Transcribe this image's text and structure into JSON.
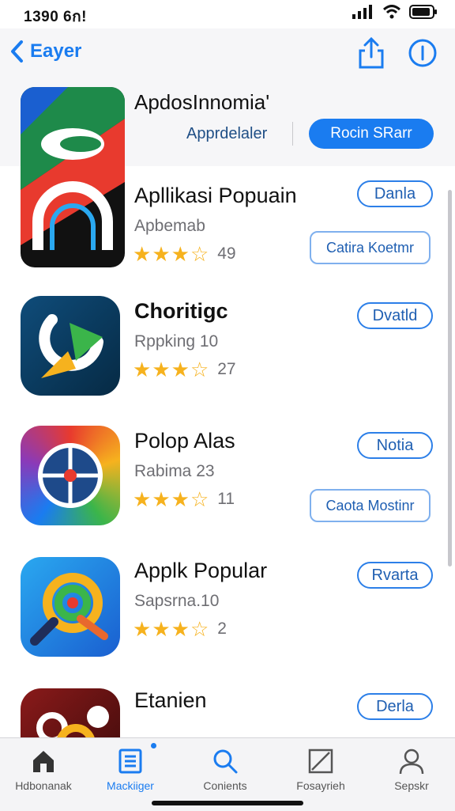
{
  "status": {
    "time": "1390 6ก!"
  },
  "nav": {
    "back_label": "Eayer"
  },
  "featured": {
    "title": "ApdosInnomia'",
    "subtitle": "Apprdelaler",
    "button": "Rocin SRarr"
  },
  "apps": [
    {
      "name": "Apllikasi Popuain",
      "subtitle": "Apbemab",
      "rating_stars": 3.5,
      "rating_count": "49",
      "action": "Danla",
      "secondary_action": "Catira Koetmr"
    },
    {
      "name": "Choritigc",
      "subtitle": "Rppking 10",
      "rating_stars": 3.5,
      "rating_count": "27",
      "action": "Dvatld",
      "secondary_action": ""
    },
    {
      "name": "Polop Alas",
      "subtitle": "Rabima 23",
      "rating_stars": 3.5,
      "rating_count": "11",
      "action": "Notia",
      "secondary_action": "Caota Mostinr"
    },
    {
      "name": "Applk Popular",
      "subtitle": "Sapsrna.10",
      "rating_stars": 3.5,
      "rating_count": "2",
      "action": "Rvarta",
      "secondary_action": ""
    },
    {
      "name": "Etanien",
      "subtitle": "",
      "rating_stars": 0,
      "rating_count": "",
      "action": "Derla",
      "secondary_action": ""
    }
  ],
  "tabs": [
    {
      "label": "Hdbonanak",
      "icon": "home-icon",
      "active": false
    },
    {
      "label": "Mackiiger",
      "icon": "list-icon",
      "active": true
    },
    {
      "label": "Conients",
      "icon": "search-icon",
      "active": false
    },
    {
      "label": "Fosayrieh",
      "icon": "edit-icon",
      "active": false
    },
    {
      "label": "Sepskr",
      "icon": "person-icon",
      "active": false
    }
  ],
  "colors": {
    "accent": "#1a7cf0",
    "star": "#f6b21e",
    "text_secondary": "#6e6e73"
  }
}
